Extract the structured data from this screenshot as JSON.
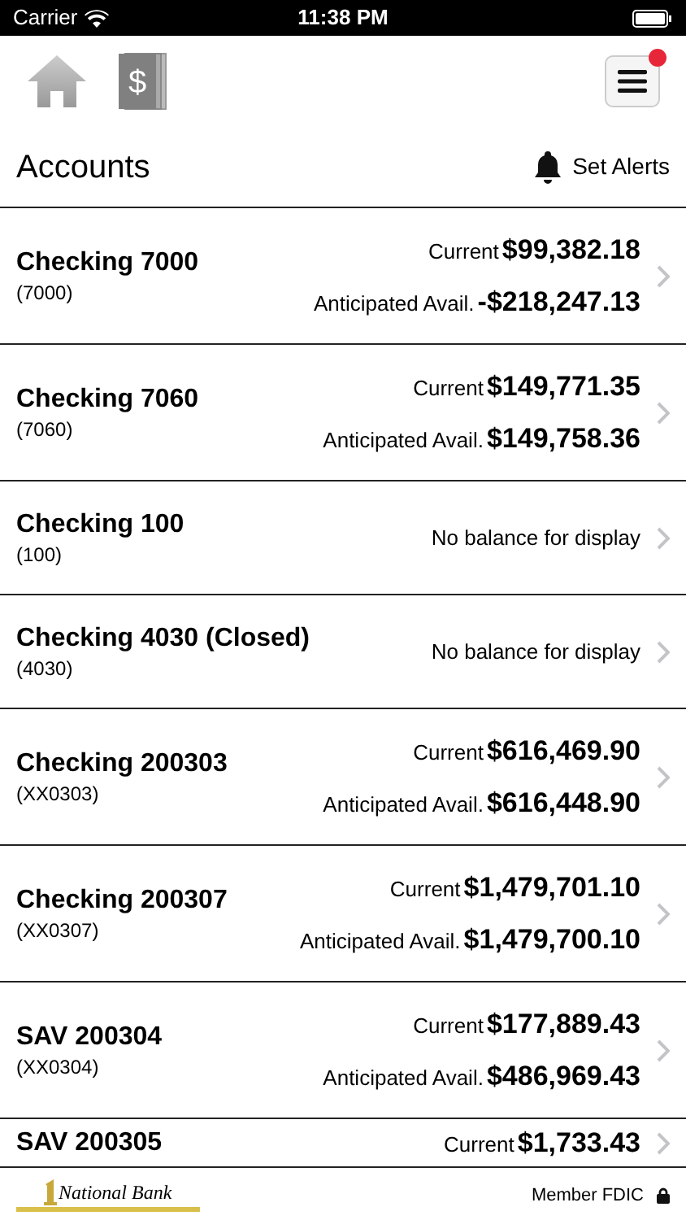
{
  "status_bar": {
    "carrier": "Carrier",
    "time": "11:38 PM"
  },
  "header": {
    "menu_badge": true,
    "cards_symbol": "$"
  },
  "title": "Accounts",
  "alerts_button": "Set Alerts",
  "accounts": [
    {
      "kind": "balance",
      "name": "Checking 7000",
      "number": "(7000)",
      "current_label": "Current",
      "current": "$99,382.18",
      "avail_label": "Anticipated Avail.",
      "avail": "-$218,247.13"
    },
    {
      "kind": "balance",
      "name": "Checking 7060",
      "number": "(7060)",
      "current_label": "Current",
      "current": "$149,771.35",
      "avail_label": "Anticipated Avail.",
      "avail": "$149,758.36"
    },
    {
      "kind": "none",
      "name": "Checking 100",
      "number": "(100)",
      "message": "No balance for display"
    },
    {
      "kind": "none",
      "name": "Checking 4030 (Closed)",
      "number": "(4030)",
      "message": "No balance for display"
    },
    {
      "kind": "balance",
      "name": "Checking 200303",
      "number": "(XX0303)",
      "current_label": "Current",
      "current": "$616,469.90",
      "avail_label": "Anticipated Avail.",
      "avail": "$616,448.90"
    },
    {
      "kind": "balance",
      "name": "Checking 200307",
      "number": "(XX0307)",
      "current_label": "Current",
      "current": "$1,479,701.10",
      "avail_label": "Anticipated Avail.",
      "avail": "$1,479,700.10"
    },
    {
      "kind": "balance",
      "name": "SAV 200304",
      "number": "(XX0304)",
      "current_label": "Current",
      "current": "$177,889.43",
      "avail_label": "Anticipated Avail.",
      "avail": "$486,969.43"
    },
    {
      "kind": "partial",
      "name": "SAV 200305",
      "current_label": "Current",
      "current": "$1,733.43"
    }
  ],
  "footer": {
    "bank": "National Bank",
    "fdic": "Member FDIC"
  }
}
